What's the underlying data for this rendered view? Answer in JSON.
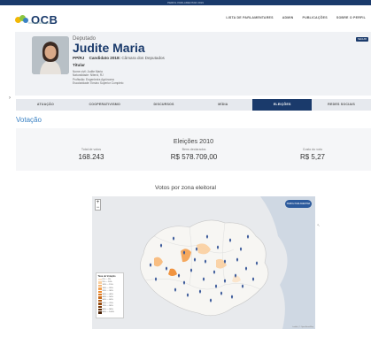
{
  "topbar": {
    "text": "PERFIL PARLAMENTAR 2019"
  },
  "brand": {
    "logo_text": "OCB",
    "logo_sub": "CONFEDERAÇÃO",
    "colors": {
      "primary": "#1a3a6b",
      "accent": "#3b82c4"
    }
  },
  "nav": {
    "links": [
      "LISTA DE PARLAMENTARES",
      "ADMIN",
      "PUBLICAÇÕES",
      "SOBRE O PERFIL"
    ]
  },
  "profile": {
    "role": "Deputado",
    "name": "Judite Maria",
    "party": "PP/RJ",
    "candidate_label": "Candidato 2018:",
    "candidate_value": "Câmara dos Deputados",
    "status": "Titular",
    "details": [
      "Nome civil: Judite Maria",
      "Naturalidade: Niterói, RJ",
      "Profissão: Engenheira Agrônoma",
      "Escolaridade: Ensino Superior Completo"
    ],
    "follow_label": "SEGUIR"
  },
  "tabs": [
    {
      "label": "ATUAÇÃO",
      "active": false
    },
    {
      "label": "COOPERATIVISMO",
      "active": false
    },
    {
      "label": "DISCURSOS",
      "active": false
    },
    {
      "label": "MÍDIA",
      "active": false
    },
    {
      "label": "ELEIÇÕES",
      "active": true
    },
    {
      "label": "REDES SOCIAIS",
      "active": false
    }
  ],
  "section": {
    "title": "Votação"
  },
  "election": {
    "title": "Eleições 2010",
    "stats": [
      {
        "label": "Total de votos",
        "value": "168.243"
      },
      {
        "label": "Bens declarados",
        "value": "R$ 578.709,00"
      },
      {
        "label": "Custo do voto",
        "value": "R$ 5,27"
      }
    ]
  },
  "map": {
    "title": "Votos por zona eleitoral",
    "zoom_in": "+",
    "zoom_out": "−",
    "legend_title": "Taxa de Votação",
    "legend": [
      {
        "label": "0% — 5%",
        "color": "#fbe3c8"
      },
      {
        "label": "5% — 10%",
        "color": "#f9cfa0"
      },
      {
        "label": "10% — 15%",
        "color": "#f7b877"
      },
      {
        "label": "15% — 20%",
        "color": "#f4a04e"
      },
      {
        "label": "20% — 30%",
        "color": "#ee8a2d"
      },
      {
        "label": "30% — 40%",
        "color": "#e07a1f"
      },
      {
        "label": "40% — 50%",
        "color": "#c96a18"
      },
      {
        "label": "50% — 60%",
        "color": "#b05a14"
      },
      {
        "label": "60% — 70%",
        "color": "#964b10"
      },
      {
        "label": "70% — 80%",
        "color": "#7c3c0c"
      },
      {
        "label": "80% — 90%",
        "color": "#632e08"
      },
      {
        "label": "90% — 100%",
        "color": "#4a2105"
      }
    ],
    "badge": "PERFIL PARLAMENTAR",
    "attribution": "Leaflet | © OpenStreetMap",
    "marker_color": "#3b5a9a"
  }
}
